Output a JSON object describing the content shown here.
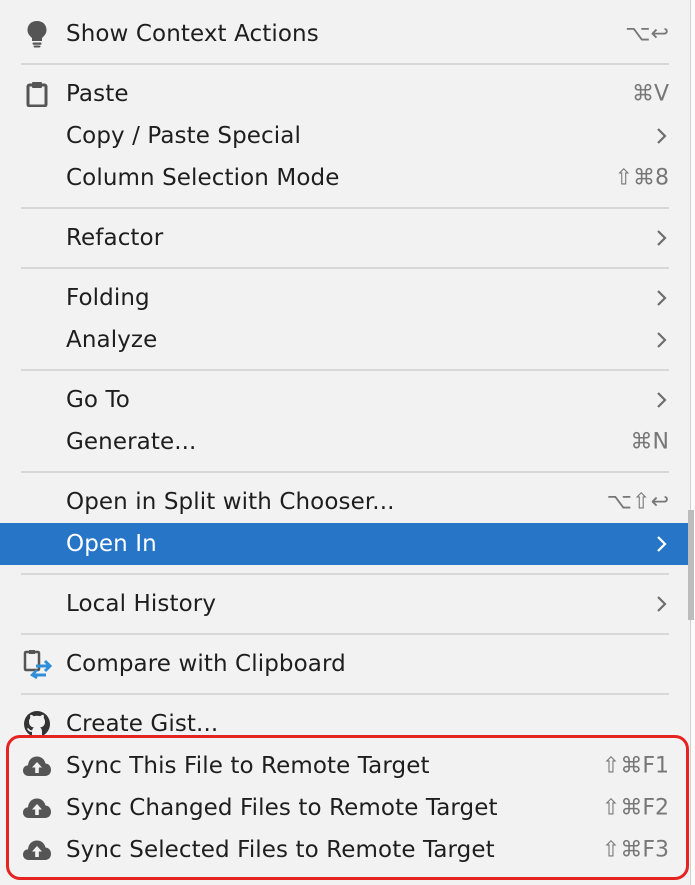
{
  "menu": {
    "show_context_actions": {
      "label": "Show Context Actions",
      "shortcut": "⌥↩",
      "icon": "lightbulb-icon"
    },
    "paste": {
      "label": "Paste",
      "shortcut": "⌘V",
      "icon": "clipboard-icon"
    },
    "copy_paste_special": {
      "label": "Copy / Paste Special",
      "submenu": true
    },
    "column_selection_mode": {
      "label": "Column Selection Mode",
      "shortcut": "⇧⌘8"
    },
    "refactor": {
      "label": "Refactor",
      "submenu": true
    },
    "folding": {
      "label": "Folding",
      "submenu": true
    },
    "analyze": {
      "label": "Analyze",
      "submenu": true
    },
    "go_to": {
      "label": "Go To",
      "submenu": true
    },
    "generate": {
      "label": "Generate...",
      "shortcut": "⌘N"
    },
    "open_in_split": {
      "label": "Open in Split with Chooser...",
      "shortcut": "⌥⇧↩"
    },
    "open_in": {
      "label": "Open In",
      "submenu": true,
      "selected": true
    },
    "local_history": {
      "label": "Local History",
      "submenu": true
    },
    "compare_with_clipboard": {
      "label": "Compare with Clipboard",
      "icon": "compare-clipboard-icon"
    },
    "create_gist": {
      "label": "Create Gist...",
      "icon": "github-icon"
    },
    "sync_this_file": {
      "label": "Sync This File to Remote Target",
      "shortcut": "⇧⌘F1",
      "icon": "cloud-upload-icon"
    },
    "sync_changed_files": {
      "label": "Sync Changed Files to Remote Target",
      "shortcut": "⇧⌘F2",
      "icon": "cloud-upload-icon"
    },
    "sync_selected_files": {
      "label": "Sync Selected Files to Remote Target",
      "shortcut": "⇧⌘F3",
      "icon": "cloud-upload-icon"
    }
  },
  "colors": {
    "selection": "#2775c7",
    "highlight_border": "#e52421",
    "menu_background": "#f2f2f2"
  }
}
